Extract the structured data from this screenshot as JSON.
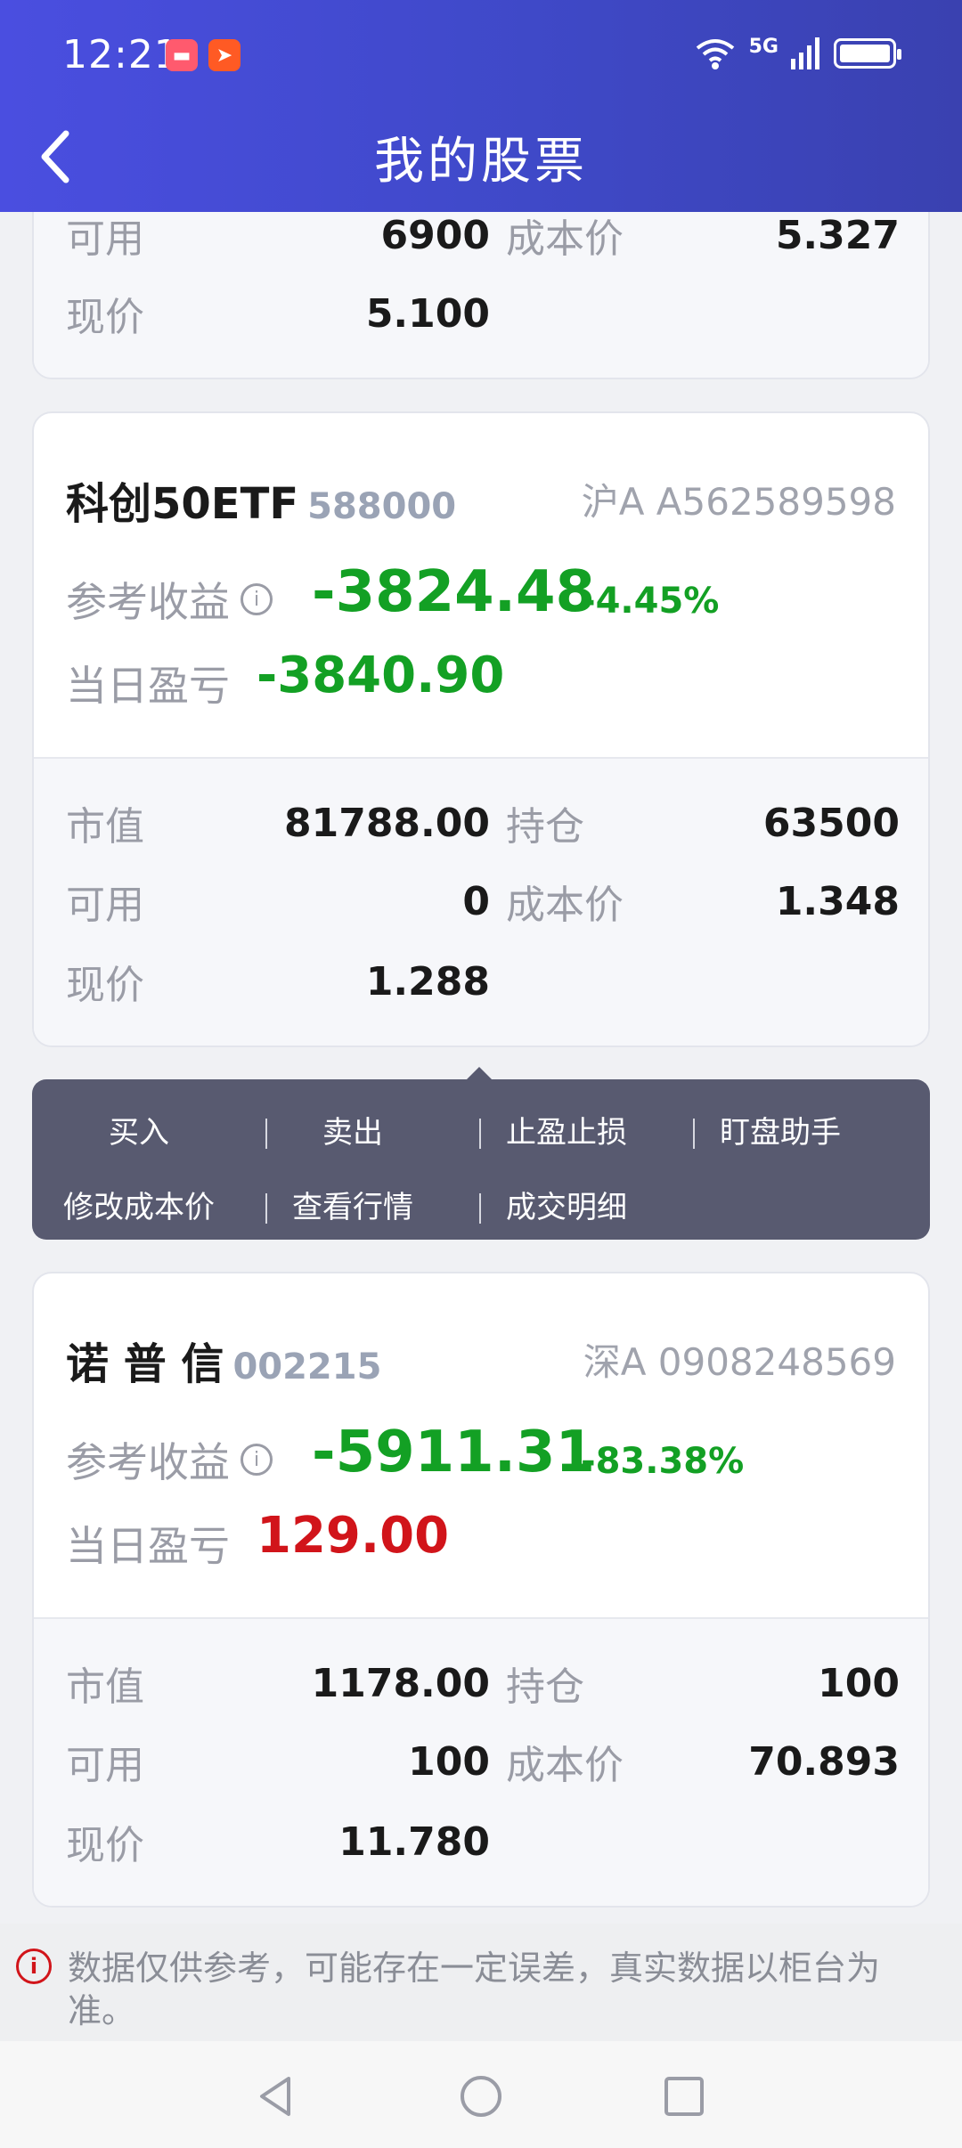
{
  "status_bar": {
    "time": "12:21",
    "network": "5G"
  },
  "header": {
    "title": "我的股票"
  },
  "card0": {
    "rows": [
      {
        "label": "可用",
        "value": "6900",
        "label2": "成本价",
        "value2": "5.327"
      },
      {
        "label": "现价",
        "value": "5.100"
      }
    ]
  },
  "card1": {
    "name": "科创50ETF",
    "code": "588000",
    "account": "沪A A562589598",
    "ref_label": "参考收益",
    "ref_value": "-3824.48",
    "ref_pct": "-4.45%",
    "day_label": "当日盈亏",
    "day_value": "-3840.90",
    "rows": [
      {
        "label": "市值",
        "value": "81788.00",
        "label2": "持仓",
        "value2": "63500"
      },
      {
        "label": "可用",
        "value": "0",
        "label2": "成本价",
        "value2": "1.348"
      },
      {
        "label": "现价",
        "value": "1.288"
      }
    ]
  },
  "menu": {
    "items": [
      "买入",
      "卖出",
      "止盈止损",
      "盯盘助手",
      "修改成本价",
      "查看行情",
      "成交明细"
    ]
  },
  "card2": {
    "name": "诺 普 信",
    "code": "002215",
    "account": "深A 0908248569",
    "ref_label": "参考收益",
    "ref_value": "-5911.31",
    "ref_pct": "-83.38%",
    "day_label": "当日盈亏",
    "day_value": "129.00",
    "rows": [
      {
        "label": "市值",
        "value": "1178.00",
        "label2": "持仓",
        "value2": "100"
      },
      {
        "label": "可用",
        "value": "100",
        "label2": "成本价",
        "value2": "70.893"
      },
      {
        "label": "现价",
        "value": "11.780"
      }
    ]
  },
  "notice": {
    "text": "数据仅供参考，可能存在一定误差，真实数据以柜台为准。"
  },
  "colors": {
    "header": "#4a4ee0",
    "loss": "#13a024",
    "gain": "#d1141a",
    "menu_bg": "#585a70"
  }
}
